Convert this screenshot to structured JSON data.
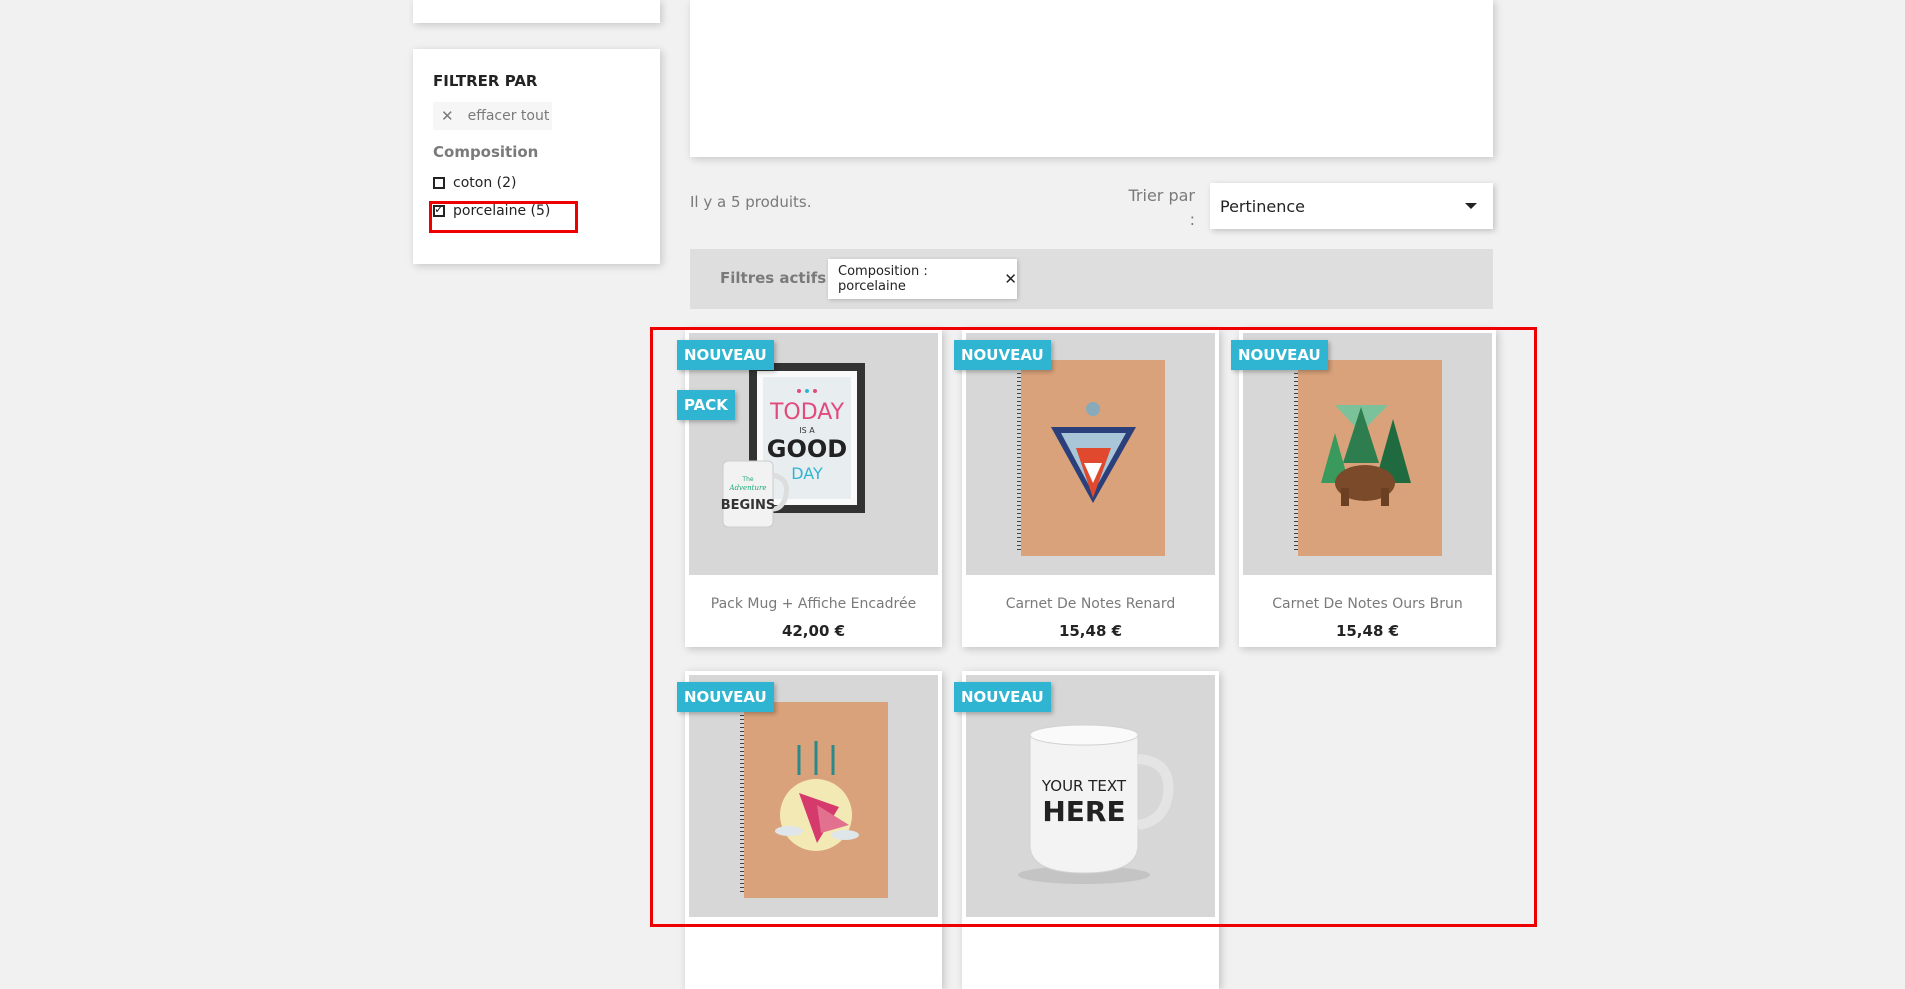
{
  "filters": {
    "title": "FILTRER PAR",
    "clear_all": "effacer tout",
    "facet_title": "Composition",
    "options": [
      {
        "label": "coton (2)",
        "checked": false
      },
      {
        "label": "porcelaine (5)",
        "checked": true
      }
    ]
  },
  "listing": {
    "count_text": "Il y a 5 produits.",
    "sort_label": "Trier par :",
    "sort_value": "Pertinence"
  },
  "active_filters": {
    "label": "Filtres actifs",
    "chips": [
      {
        "text": "Composition : porcelaine"
      }
    ]
  },
  "products": [
    {
      "name": "Pack Mug + Affiche Encadrée",
      "price": "42,00 €",
      "flags": [
        "NOUVEAU",
        "PACK"
      ]
    },
    {
      "name": "Carnet De Notes Renard",
      "price": "15,48 €",
      "flags": [
        "NOUVEAU"
      ]
    },
    {
      "name": "Carnet De Notes Ours Brun",
      "price": "15,48 €",
      "flags": [
        "NOUVEAU"
      ]
    },
    {
      "name": "",
      "price": "",
      "flags": [
        "NOUVEAU"
      ]
    },
    {
      "name": "",
      "price": "",
      "flags": [
        "NOUVEAU"
      ]
    }
  ],
  "artwork_text": {
    "poster": [
      "TODAY",
      "IS A",
      "GOOD",
      "DAY"
    ],
    "mug_small": [
      "The",
      "Adventure",
      "BEGINS"
    ],
    "mug_big": [
      "YOUR TEXT",
      "HERE"
    ]
  },
  "colors": {
    "flag": "#2fb5d2",
    "highlight": "#ee0000",
    "notebook": "#d9a27a"
  }
}
